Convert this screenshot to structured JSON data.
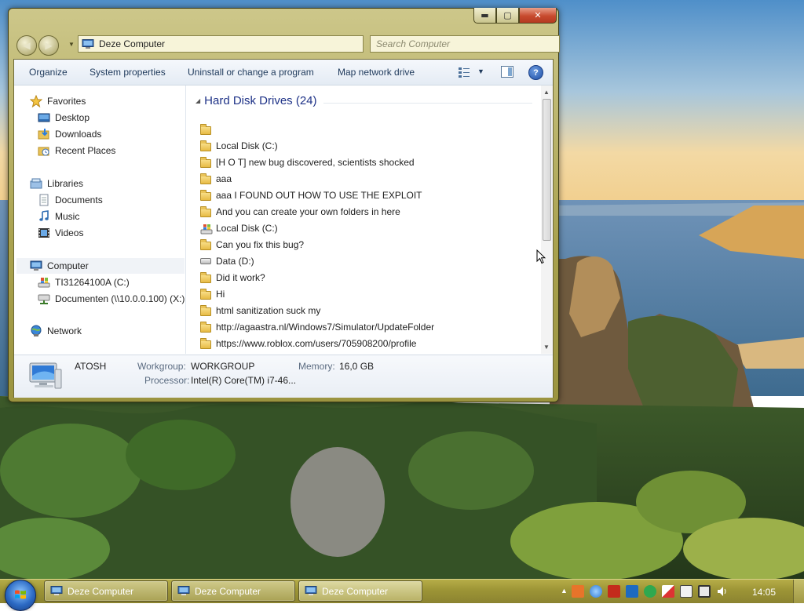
{
  "window": {
    "address_text": "Deze Computer",
    "search_placeholder": "Search Computer"
  },
  "toolbar": {
    "organize": "Organize",
    "system_properties": "System properties",
    "uninstall": "Uninstall or change a program",
    "map_drive": "Map network drive"
  },
  "nav_pane": {
    "favorites": "Favorites",
    "desktop": "Desktop",
    "downloads": "Downloads",
    "recent": "Recent Places",
    "libraries": "Libraries",
    "documents": "Documents",
    "music": "Music",
    "videos": "Videos",
    "computer": "Computer",
    "drive_c": "TI31264100A (C:)",
    "drive_x": "Documenten (\\\\10.0.0.100) (X:)",
    "network": "Network"
  },
  "file_pane": {
    "group_header": "Hard Disk Drives (24)",
    "items": [
      {
        "label": "",
        "icon": "folder"
      },
      {
        "label": "Local Disk (C:)",
        "icon": "folder"
      },
      {
        "label": "[H O T] new bug discovered, scientists shocked",
        "icon": "folder"
      },
      {
        "label": "aaa",
        "icon": "folder"
      },
      {
        "label": "aaa I FOUND OUT HOW TO USE THE EXPLOIT",
        "icon": "folder"
      },
      {
        "label": "And you can create your own folders in here",
        "icon": "folder"
      },
      {
        "label": "Local Disk (C:)",
        "icon": "windows-drive"
      },
      {
        "label": "Can you fix this bug?",
        "icon": "folder"
      },
      {
        "label": "Data (D:)",
        "icon": "hard-drive"
      },
      {
        "label": "Did it work?",
        "icon": "folder"
      },
      {
        "label": "Hi",
        "icon": "folder"
      },
      {
        "label": "html sanitization suck my",
        "icon": "folder"
      },
      {
        "label": "http://agaastra.nl/Windows7/Simulator/UpdateFolder",
        "icon": "folder"
      },
      {
        "label": "https://www.roblox.com/users/705908200/profile",
        "icon": "folder"
      }
    ]
  },
  "details": {
    "computer_name": "ATOSH",
    "workgroup_label": "Workgroup:",
    "workgroup_value": "WORKGROUP",
    "memory_label": "Memory:",
    "memory_value": "16,0 GB",
    "processor_label": "Processor:",
    "processor_value": "Intel(R) Core(TM) i7-46..."
  },
  "taskbar": {
    "tasks": [
      "Deze Computer",
      "Deze Computer",
      "Deze Computer"
    ],
    "clock": "14:05",
    "tray_icons": [
      "java-icon",
      "network-globe-icon",
      "pdf-icon",
      "outlook-icon",
      "security-check-icon",
      "flag-alert-icon",
      "clipboard-icon",
      "display-icon",
      "volume-icon"
    ]
  },
  "colors": {
    "window_frame": "#a9a24f",
    "taskbar": "#9c9436",
    "link_blue": "#1e3287"
  }
}
